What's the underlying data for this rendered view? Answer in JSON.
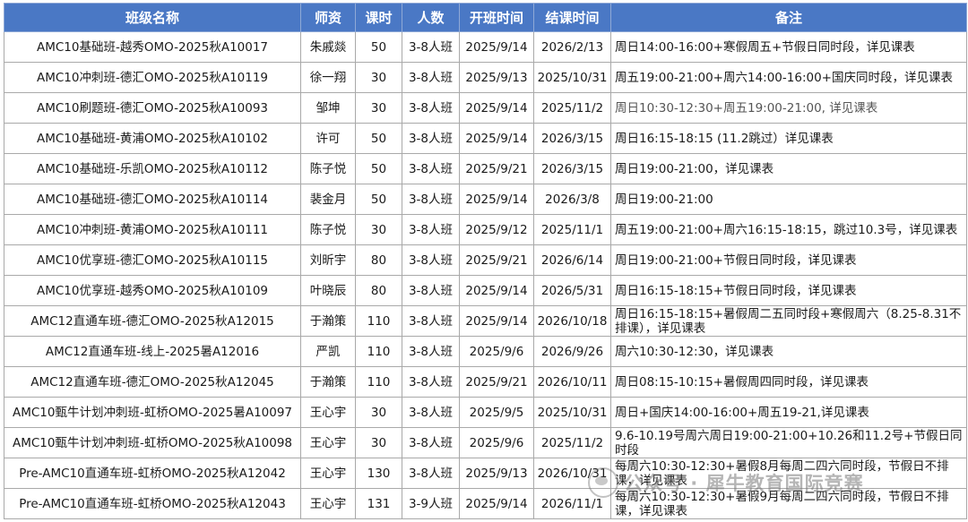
{
  "headers": [
    "班级名称",
    "师资",
    "课时",
    "人数",
    "开班时间",
    "结课时间",
    "备注"
  ],
  "rows": [
    [
      "AMC10基础班-越秀OMO-2025秋A10017",
      "朱戚燚",
      "50",
      "3-8人班",
      "2025/9/14",
      "2026/2/13",
      "周日14:00-16:00+寒假周五+节假日同时段，详见课表"
    ],
    [
      "AMC10冲刺班-德汇OMO-2025秋A10119",
      "徐一翔",
      "30",
      "3-8人班",
      "2025/9/13",
      "2025/10/31",
      "周五19:00-21:00+周六14:00-16:00+国庆同时段，详见课表"
    ],
    [
      "AMC10刷题班-德汇OMO-2025秋A10093",
      "邹坤",
      "30",
      "3-8人班",
      "2025/9/14",
      "2025/11/2",
      "周日10:30-12:30+周五19:00-21:00, 详见课表"
    ],
    [
      "AMC10基础班-黄浦OMO-2025秋A10102",
      "许可",
      "50",
      "3-8人班",
      "2025/9/14",
      "2026/3/15",
      "周日16:15-18:15 (11.2跳过）详见课表"
    ],
    [
      "AMC10基础班-乐凯OMO-2025秋A10112",
      "陈子悦",
      "50",
      "3-8人班",
      "2025/9/21",
      "2026/3/15",
      "周日19:00-21:00，详见课表"
    ],
    [
      "AMC10基础班-德汇OMO-2025秋A10114",
      "裴金月",
      "50",
      "3-8人班",
      "2025/9/14",
      "2026/3/8",
      "周日19:00-21:00"
    ],
    [
      "AMC10冲刺班-黄浦OMO-2025秋A10111",
      "陈子悦",
      "30",
      "3-8人班",
      "2025/9/12",
      "2025/11/1",
      "周五19:00-21:00+周六16:15-18:15，跳过10.3号，详见课表"
    ],
    [
      "AMC10优享班-德汇OMO-2025秋A10115",
      "刘昕宇",
      "80",
      "3-8人班",
      "2025/9/21",
      "2026/6/14",
      "周日19:00-21:00+节假日同时段，详见课表"
    ],
    [
      "AMC10优享班-越秀OMO-2025秋A10109",
      "叶晓辰",
      "80",
      "3-8人班",
      "2025/9/14",
      "2026/5/31",
      "周日16:15-18:15+节假日同时段，详见课表"
    ],
    [
      "AMC12直通车班-德汇OMO-2025秋A12015",
      "于瀚策",
      "110",
      "3-8人班",
      "2025/9/14",
      "2026/10/18",
      "周日16:15-18:15+暑假周二五同时段+寒假周六（8.25-8.31不排课），详见课表"
    ],
    [
      "AMC12直通车班-线上-2025暑A12016",
      "严凯",
      "110",
      "3-8人班",
      "2025/9/6",
      "2026/9/26",
      "周六10:30-12:30，详见课表"
    ],
    [
      "AMC12直通车班-德汇OMO-2025秋A12045",
      "于瀚策",
      "110",
      "3-8人班",
      "2025/9/21",
      "2026/10/11",
      "周日08:15-10:15+暑假周四同时段，详见课表"
    ],
    [
      "AMC10甄牛计划冲刺班-虹桥OMO-2025暑A10097",
      "王心宇",
      "30",
      "3-8人班",
      "2025/9/5",
      "2025/10/31",
      "周日+国庆14:00-16:00+周五19-21,详见课表"
    ],
    [
      "AMC10甄牛计划冲刺班-虹桥OMO-2025秋A10098",
      "王心宇",
      "30",
      "3-8人班",
      "2025/9/6",
      "2025/11/2",
      "9.6-10.19号周六周日19:00-21:00+10.26和11.2号+节假日同时段"
    ],
    [
      "Pre-AMC10直通车班-虹桥OMO-2025秋A12042",
      "王心宇",
      "130",
      "3-8人班",
      "2025/9/13",
      "2026/10/31",
      "每周六10:30-12:30+暑假8月每周二四六同时段，节假日不排课，详见课表"
    ],
    [
      "Pre-AMC10直通车班-虹桥OMO-2025秋A12043",
      "王心宇",
      "131",
      "3-9人班",
      "2025/9/14",
      "2026/11/1",
      "每周六10:30-12:30+暑假9月每周二四六同时段，节假日不排课，详见课表"
    ]
  ],
  "dim_notes": [
    2
  ],
  "watermark": "公众号 · 犀牛教育国际竞赛",
  "colors": {
    "header_bg": "#4a78c5",
    "header_text": "#ffffff",
    "grid": "#a9a9a9"
  }
}
